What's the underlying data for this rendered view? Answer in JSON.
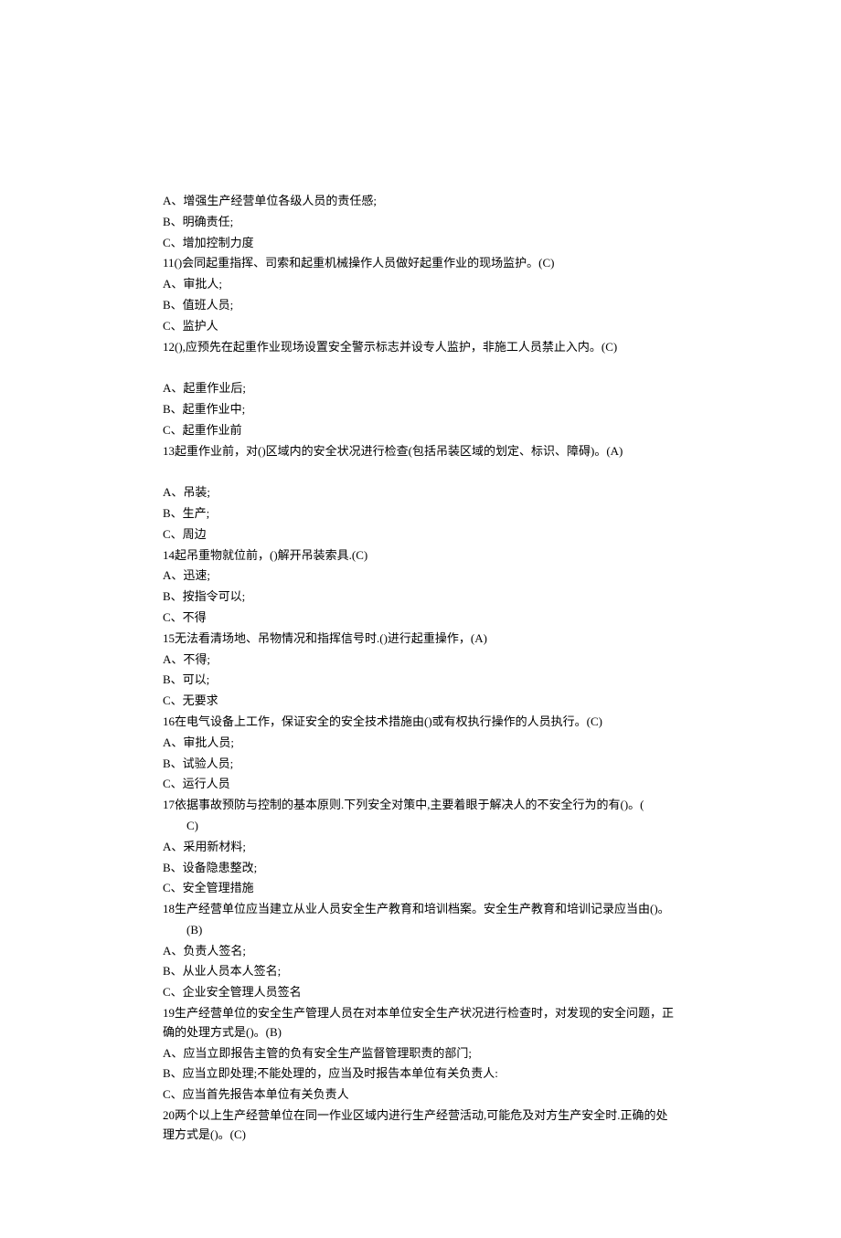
{
  "lines": [
    {
      "text": "A、增强生产经营单位各级人员的责任感;",
      "indent": false
    },
    {
      "text": "B、明确责任;",
      "indent": false
    },
    {
      "text": "C、增加控制力度",
      "indent": false
    },
    {
      "text": "11()会同起重指挥、司索和起重机械操作人员做好起重作业的现场监护。(C)",
      "indent": false
    },
    {
      "text": "A、审批人;",
      "indent": false
    },
    {
      "text": "B、值班人员;",
      "indent": false
    },
    {
      "text": "C、监护人",
      "indent": false
    },
    {
      "text": "12(),应预先在起重作业现场设置安全警示标志并设专人监护，非施工人员禁止入内。(C)",
      "indent": false
    },
    {
      "text": " ",
      "indent": false
    },
    {
      "text": "A、起重作业后;",
      "indent": false
    },
    {
      "text": "B、起重作业中;",
      "indent": false
    },
    {
      "text": "C、起重作业前",
      "indent": false
    },
    {
      "text": "13起重作业前，对()区域内的安全状况进行检查(包括吊装区域的划定、标识、障碍)。(A)",
      "indent": false
    },
    {
      "text": " ",
      "indent": false
    },
    {
      "text": "A、吊装;",
      "indent": false
    },
    {
      "text": "B、生产;",
      "indent": false
    },
    {
      "text": "C、周边",
      "indent": false
    },
    {
      "text": "14起吊重物就位前，()解开吊装索具.(C)",
      "indent": false
    },
    {
      "text": "A、迅速;",
      "indent": false
    },
    {
      "text": "B、按指令可以;",
      "indent": false
    },
    {
      "text": "C、不得",
      "indent": false
    },
    {
      "text": "15无法看清场地、吊物情况和指挥信号时.()进行起重操作，(A)",
      "indent": false
    },
    {
      "text": "A、不得;",
      "indent": false
    },
    {
      "text": "B、可以;",
      "indent": false
    },
    {
      "text": "C、无要求",
      "indent": false
    },
    {
      "text": "16在电气设备上工作，保证安全的安全技术措施由()或有权执行操作的人员执行。(C)",
      "indent": false
    },
    {
      "text": "A、审批人员;",
      "indent": false
    },
    {
      "text": "B、试验人员;",
      "indent": false
    },
    {
      "text": "C、运行人员",
      "indent": false
    },
    {
      "text": "17依据事故预防与控制的基本原则.下列安全对策中,主要着眼于解决人的不安全行为的有()。(",
      "indent": false
    },
    {
      "text": "C)",
      "indent": true
    },
    {
      "text": "A、采用新材料;",
      "indent": false
    },
    {
      "text": "B、设备隐患整改;",
      "indent": false
    },
    {
      "text": "C、安全管理措施",
      "indent": false
    },
    {
      "text": "18生产经营单位应当建立从业人员安全生产教育和培训档案。安全生产教育和培训记录应当由()。",
      "indent": false
    },
    {
      "text": "(B)",
      "indent": true
    },
    {
      "text": "A、负责人签名;",
      "indent": false
    },
    {
      "text": "B、从业人员本人签名;",
      "indent": false
    },
    {
      "text": "C、企业安全管理人员签名",
      "indent": false
    },
    {
      "text": "19生产经营单位的安全生产管理人员在对本单位安全生产状况进行检查时，对发现的安全问题，正确的处理方式是()。(B)",
      "indent": false
    },
    {
      "text": "A、应当立即报告主管的负有安全生产监督管理职责的部门;",
      "indent": false
    },
    {
      "text": "B、应当立即处理;不能处理的，应当及时报告本单位有关负责人:",
      "indent": false
    },
    {
      "text": "C、应当首先报告本单位有关负责人",
      "indent": false
    },
    {
      "text": "20两个以上生产经营单位在同一作业区域内进行生产经营活动,可能危及对方生产安全时.正确的处理方式是()。(C)",
      "indent": false
    }
  ]
}
